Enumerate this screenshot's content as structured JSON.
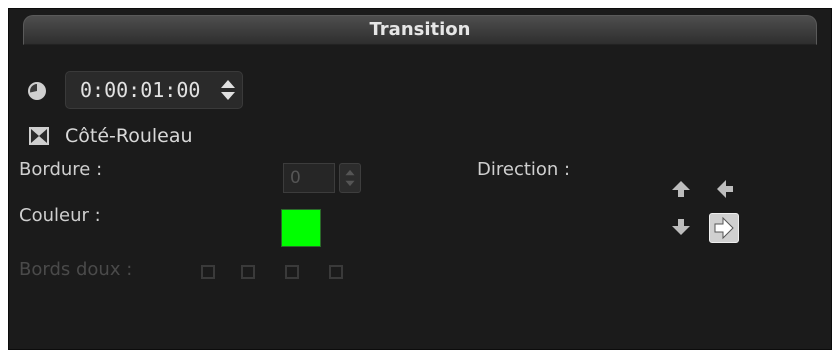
{
  "panel": {
    "title": "Transition"
  },
  "duration": {
    "value": "0:00:01:00"
  },
  "transition": {
    "name": "Côté-Rouleau"
  },
  "border": {
    "label": "Bordure :",
    "value": "0"
  },
  "color": {
    "label": "Couleur :",
    "swatch": "#00ff00"
  },
  "soft_edges": {
    "label": "Bords doux :"
  },
  "direction": {
    "label": "Direction :",
    "selected": "right"
  },
  "icons": [
    "clock-icon",
    "transition-icon",
    "spinner-arrows-icon",
    "arrow-up-icon",
    "arrow-left-icon",
    "arrow-down-icon",
    "arrow-right-icon"
  ]
}
